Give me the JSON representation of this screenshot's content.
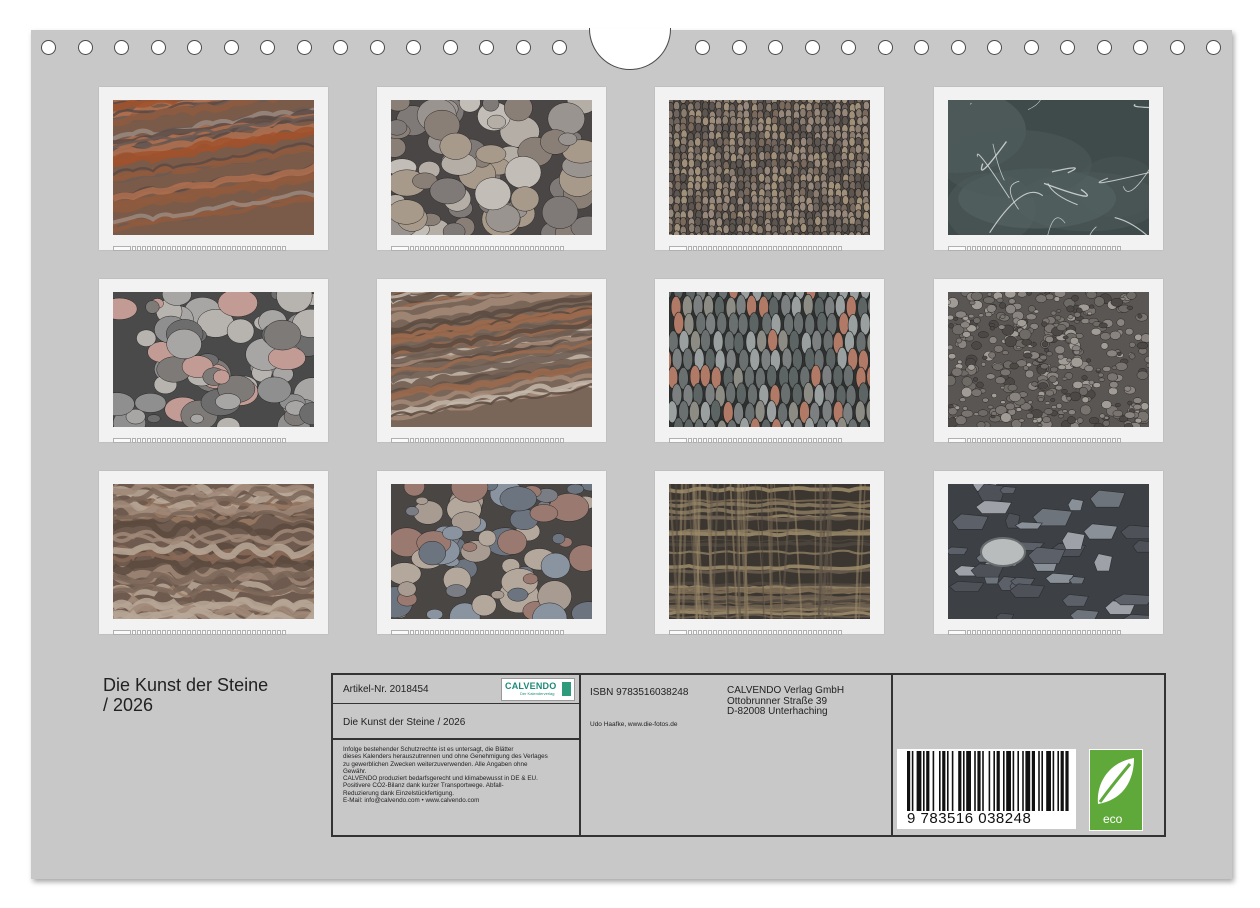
{
  "calendar": {
    "title_line1": "Die Kunst der Steine",
    "title_line2": "/ 2026"
  },
  "thumbnails": [
    {
      "theme": "layered-rock-reddish"
    },
    {
      "theme": "round-pebbles"
    },
    {
      "theme": "pebble-mosaic"
    },
    {
      "theme": "dark-slate-veins"
    },
    {
      "theme": "beach-stones-grey"
    },
    {
      "theme": "layered-rock-brown"
    },
    {
      "theme": "upright-pebbles"
    },
    {
      "theme": "fine-gravel"
    },
    {
      "theme": "folded-rock-layers"
    },
    {
      "theme": "smooth-pebbles"
    },
    {
      "theme": "dark-rock-face"
    },
    {
      "theme": "blue-grey-slate-stones"
    }
  ],
  "info_box": {
    "article_label": "Artikel-Nr. 2018454",
    "logo_text": "CALVENDO",
    "logo_subtext": "Der Kalenderverlag",
    "calendar_title": "Die Kunst der Steine / 2026",
    "legal_lines": [
      "Infolge bestehender Schutzrechte ist es untersagt, die Blätter",
      "dieses Kalenders herauszutrennen und ohne Genehmigung des Verlages",
      "zu gewerblichen Zwecken weiterzuverwenden. Alle Angaben ohne",
      "Gewähr.",
      "CALVENDO produziert bedarfsgerecht und klimabewusst in DE & EU.",
      "Positivere CO2-Bilanz dank kurzer Transportwege. Abfall-",
      "Reduzierung dank Einzelstückfertigung.",
      "E-Mail: info@calvendo.com • www.calvendo.com"
    ],
    "isbn": "ISBN 9783516038248",
    "author": "Udo Haafke, www.die-fotos.de",
    "publisher_lines": [
      "CALVENDO Verlag GmbH",
      "Ottobrunner Straße 39",
      "D-82008 Unterhaching"
    ],
    "barcode_number": "9 783516 038248",
    "eco_label": "eco"
  },
  "colors": {
    "page_background": "#c8c8c8",
    "eco_green": "#5ea93a"
  }
}
